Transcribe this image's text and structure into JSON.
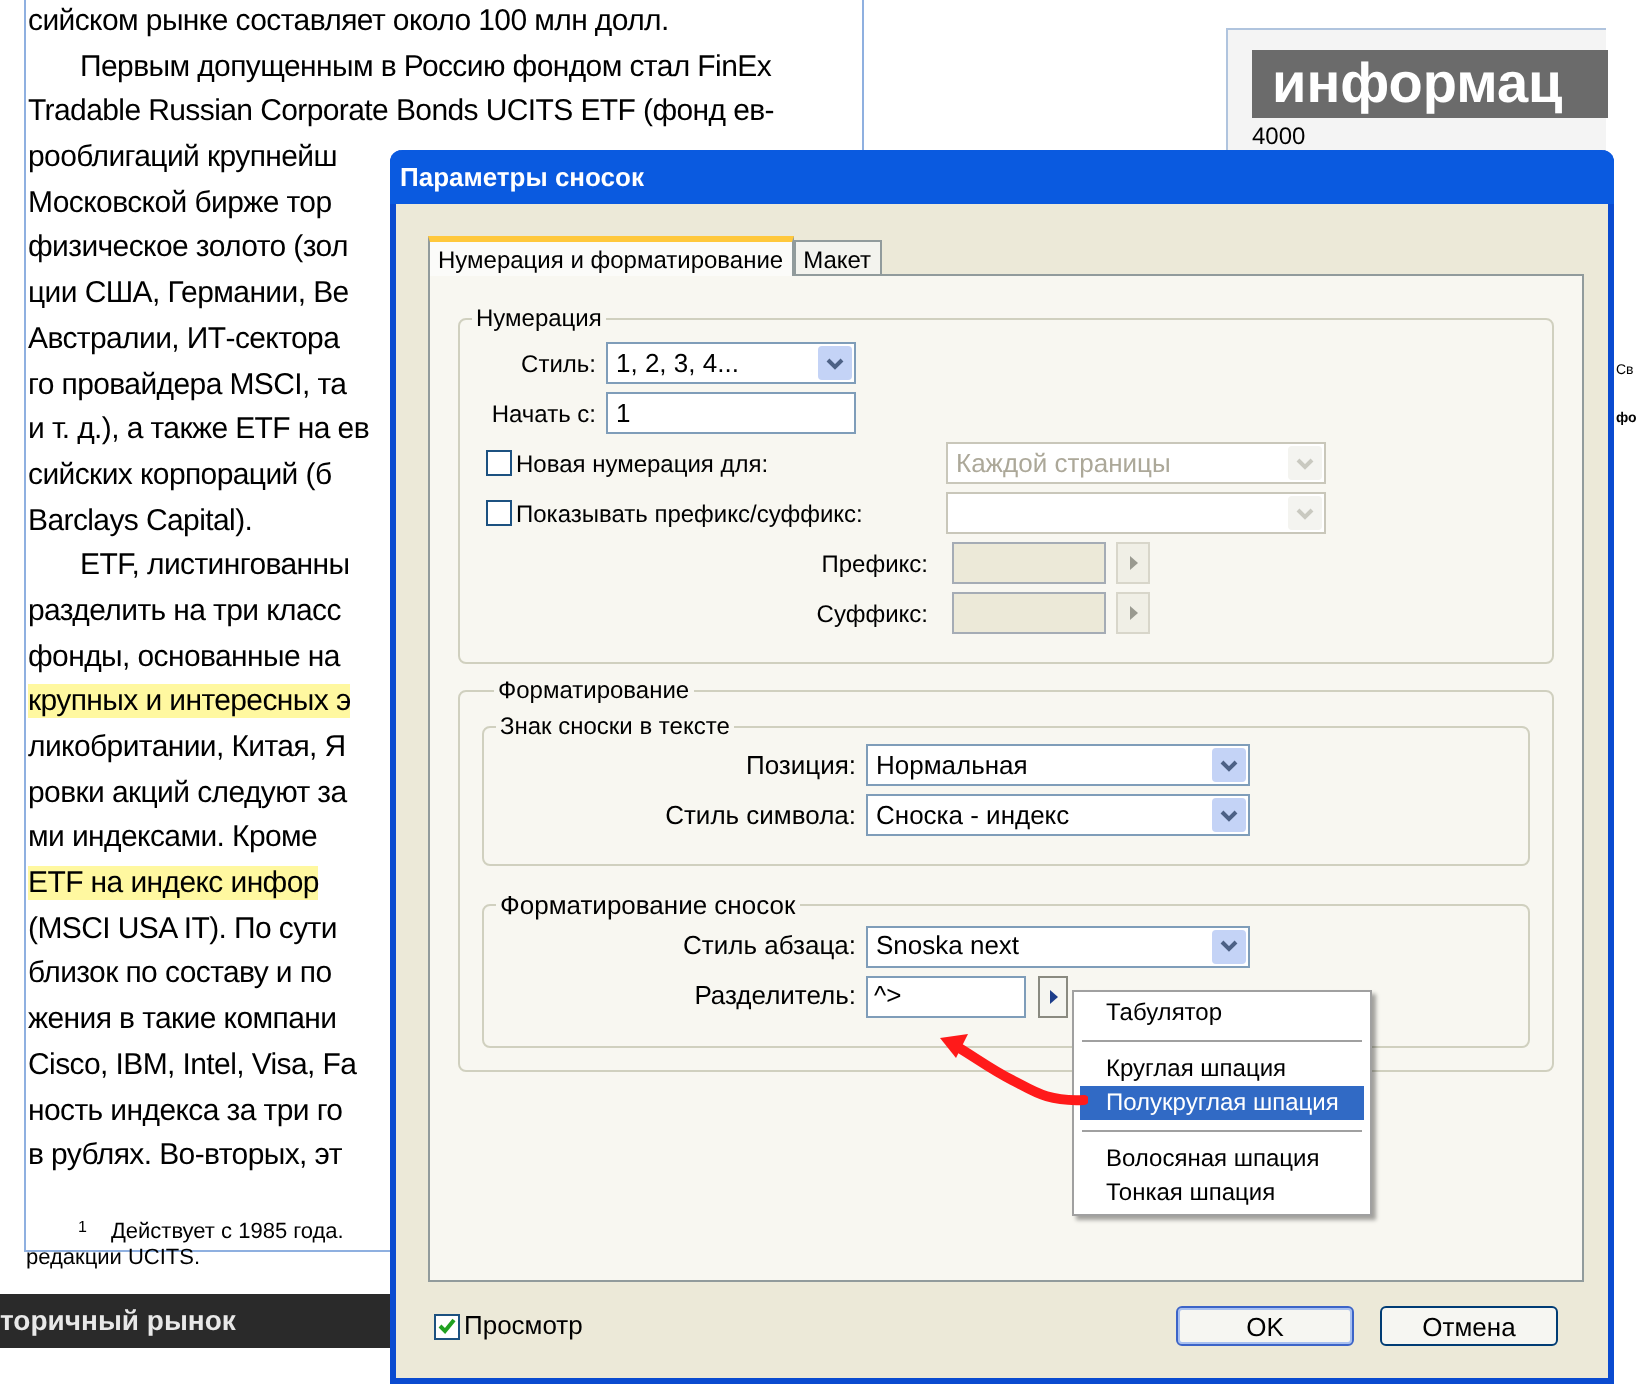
{
  "document": {
    "lines": [
      {
        "text": "сийском рынке составляет около 100 млн долл.",
        "indent": false,
        "highlight": false
      },
      {
        "text": "Первым допущенным в Россию фондом стал FinEx",
        "indent": true,
        "highlight": false
      },
      {
        "text": "Tradable Russian Corporate Bonds UCITS ETF (фонд ев-",
        "indent": false,
        "highlight": false
      },
      {
        "text": "рооблигаций крупнейш",
        "indent": false,
        "highlight": false
      },
      {
        "text": "Московской бирже тор",
        "indent": false,
        "highlight": false
      },
      {
        "text": "физическое золото (зол",
        "indent": false,
        "highlight": false
      },
      {
        "text": "ции США, Германии, Ве",
        "indent": false,
        "highlight": false
      },
      {
        "text": "Австралии, ИТ-сектора",
        "indent": false,
        "highlight": false
      },
      {
        "text": "го провайдера MSCI, та",
        "indent": false,
        "highlight": false
      },
      {
        "text": "и т. д.), а также ETF на ев",
        "indent": false,
        "highlight": false
      },
      {
        "text": "сийских корпораций (б",
        "indent": false,
        "highlight": false
      },
      {
        "text": "Barclays Capital).",
        "indent": false,
        "highlight": false
      },
      {
        "text": "ETF, листингованны",
        "indent": true,
        "highlight": false
      },
      {
        "text": "разделить на три класс",
        "indent": false,
        "highlight": false
      },
      {
        "text": "фонды, основанные на",
        "indent": false,
        "highlight": false
      },
      {
        "text": "крупных и интересных э",
        "indent": false,
        "highlight": true
      },
      {
        "text": "ликобритании, Китая, Я",
        "indent": false,
        "highlight": false
      },
      {
        "text": "ровки акций следуют за",
        "indent": false,
        "highlight": false
      },
      {
        "text": "ми индексами. Кроме",
        "indent": false,
        "highlight": false
      },
      {
        "text": "ETF на индекс инфор",
        "indent": false,
        "highlight": true
      },
      {
        "text": "(MSCI USA IT). По сути",
        "indent": false,
        "highlight": false
      },
      {
        "text": "близок по составу и по",
        "indent": false,
        "highlight": false
      },
      {
        "text": "жения в такие компани",
        "indent": false,
        "highlight": false
      },
      {
        "text": "Cisco, IBM, Intel, Visa, Fa",
        "indent": false,
        "highlight": false
      },
      {
        "text": "ность индекса за три го",
        "indent": false,
        "highlight": false
      },
      {
        "text": "в рублях. Во-вторых, эт",
        "indent": false,
        "highlight": false
      }
    ],
    "footnote": {
      "mark": "1",
      "text": "Действует с 1985 года.",
      "continuation": "редакции UCITS."
    },
    "bottom_bar": "торичный рынок"
  },
  "side_panel": {
    "banner": "информац",
    "number": "4000",
    "tab_label": "Св",
    "bold_text": "фо"
  },
  "dialog": {
    "title": "Параметры сносок",
    "tabs": [
      {
        "label": "Нумерация и форматирование",
        "selected": true
      },
      {
        "label": "Макет",
        "selected": false
      }
    ],
    "numbering": {
      "legend": "Нумерация",
      "style": {
        "label": "Стиль:",
        "value": "1, 2, 3, 4..."
      },
      "start": {
        "label": "Начать с:",
        "value": "1"
      },
      "restart": {
        "label": "Новая нумерация для:",
        "checked": false,
        "value": "Каждой страницы",
        "disabled": true
      },
      "prefix_suffix": {
        "label": "Показывать префикс/суффикс:",
        "checked": false,
        "disabled": true
      },
      "prefix": {
        "label": "Префикс:",
        "disabled": true
      },
      "suffix": {
        "label": "Суффикс:",
        "disabled": true
      }
    },
    "formatting": {
      "legend": "Форматирование",
      "marker": {
        "legend": "Знак сноски в тексте",
        "position": {
          "label": "Позиция:",
          "value": "Нормальная"
        },
        "char_style": {
          "label": "Стиль символа:",
          "value": "Сноска - индекс"
        }
      },
      "note": {
        "legend": "Форматирование сносок",
        "para_style": {
          "label": "Стиль абзаца:",
          "value": "Snoska next"
        },
        "separator": {
          "label": "Разделитель:",
          "value": "^>"
        }
      }
    },
    "menu": {
      "items": [
        {
          "kind": "item",
          "label": "Табулятор",
          "selected": false
        },
        {
          "kind": "separator"
        },
        {
          "kind": "item",
          "label": "Круглая шпация",
          "selected": false
        },
        {
          "kind": "item",
          "label": "Полукруглая шпация",
          "selected": true
        },
        {
          "kind": "separator"
        },
        {
          "kind": "item",
          "label": "Волосяная шпация",
          "selected": false
        },
        {
          "kind": "item",
          "label": "Тонкая шпация",
          "selected": false
        }
      ]
    },
    "preview": {
      "label": "Просмотр",
      "checked": true
    },
    "buttons": [
      {
        "label": "OK",
        "kind": "default"
      },
      {
        "label": "Отмена",
        "kind": "normal"
      }
    ]
  }
}
